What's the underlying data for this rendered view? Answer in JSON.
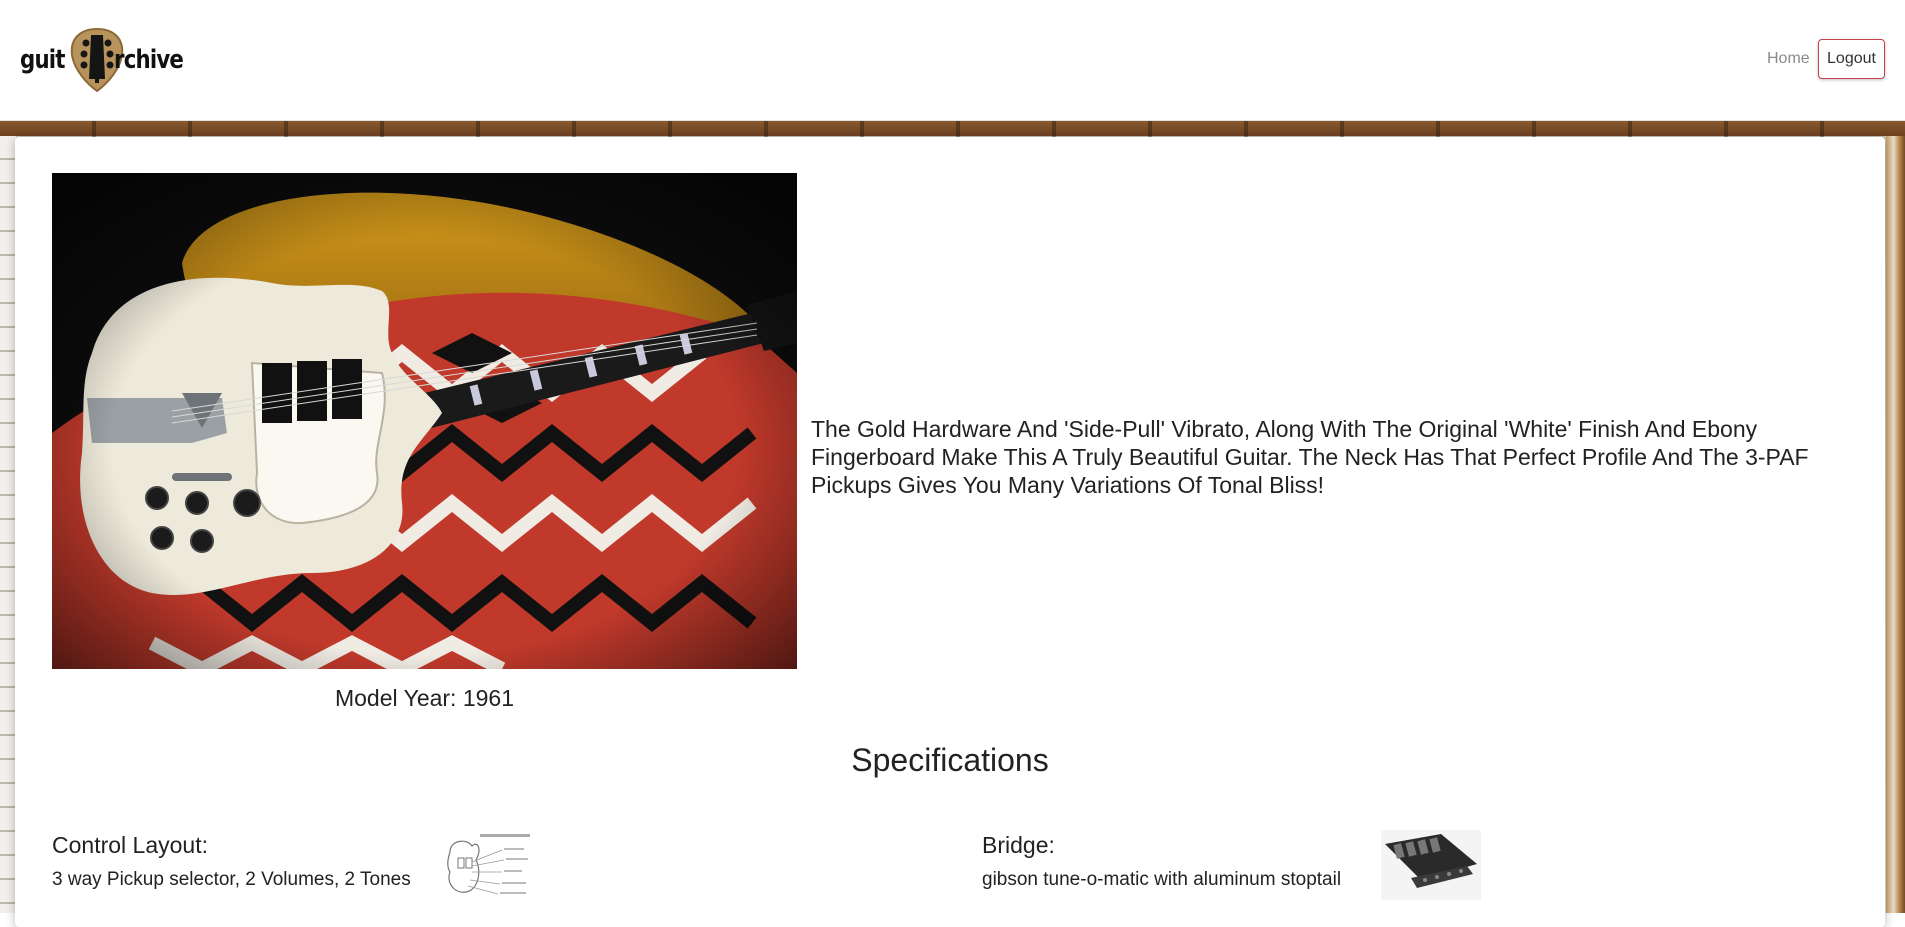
{
  "header": {
    "logo": {
      "left": "guit",
      "right": "rchive",
      "icon": "guitar-pick-headstock-icon"
    },
    "nav": {
      "home": "Home",
      "logout": "Logout"
    },
    "accent_color": "#c9404a"
  },
  "guitar": {
    "image": "white-sg-guitar-photo",
    "description": "The Gold Hardware And 'Side-Pull' Vibrato, Along With The Original 'White' Finish And Ebony Fingerboard Make This A Truly Beautiful Guitar. The Neck Has That Perfect Profile And The 3-PAF Pickups Gives You Many Variations Of Tonal Bliss!",
    "model_year_label": "Model Year:",
    "model_year": "1961"
  },
  "specifications": {
    "title": "Specifications",
    "items": [
      {
        "label": "Control Layout:",
        "value": "3 way Pickup selector, 2 Volumes, 2 Tones",
        "thumbnail": "wiring-diagram-thumbnail"
      },
      {
        "label": "Bridge:",
        "value": "gibson tune-o-matic with aluminum stoptail",
        "thumbnail": "bridge-photo-thumbnail"
      }
    ]
  }
}
